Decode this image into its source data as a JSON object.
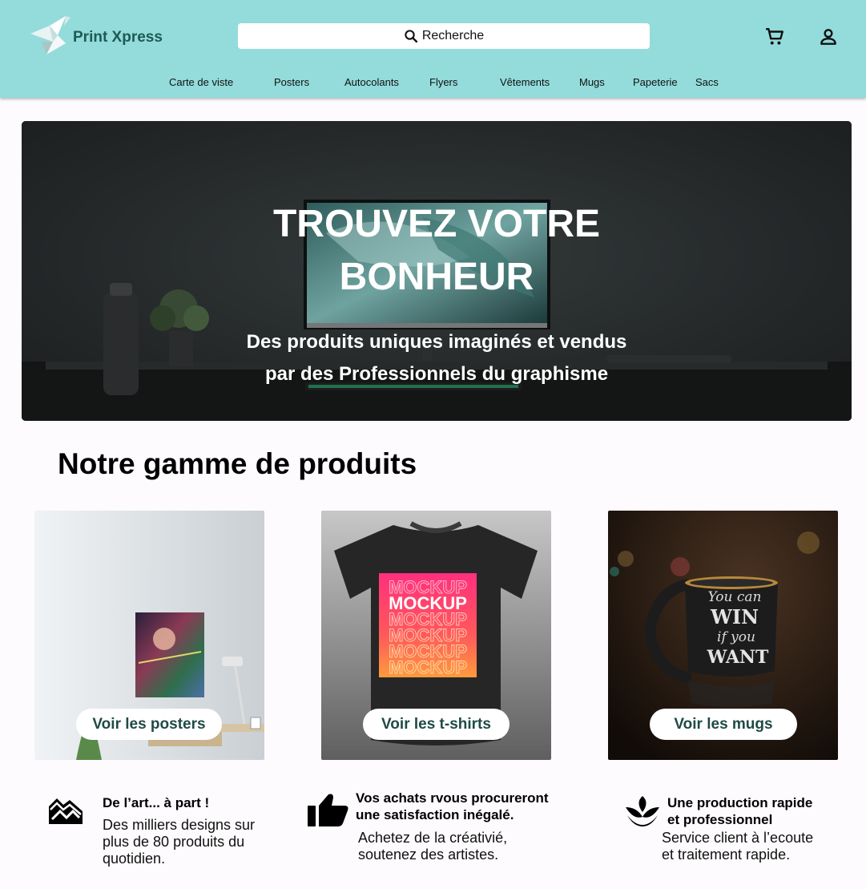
{
  "header": {
    "brand": "Print Xpress",
    "search_label": "Recherche",
    "nav": [
      "Carte de viste",
      "Posters",
      "Autocolants",
      "Flyers",
      "Vêtements",
      "Mugs",
      "Papeterie",
      "Sacs"
    ],
    "icons": [
      "origami-bird-logo",
      "search-icon",
      "cart-icon",
      "account-icon"
    ],
    "colors": {
      "header_bg": "#93dcdb",
      "brand_text": "#1f5a55"
    }
  },
  "hero": {
    "title_line1": "TROUVEZ VOTRE",
    "title_line2": "BONHEUR",
    "subtitle_line1": "Des produits uniques imaginés et vendus",
    "subtitle_line2": "par des Professionnels du graphisme"
  },
  "products": {
    "title": "Notre gamme de produits",
    "cards": [
      {
        "button": "Voir les posters"
      },
      {
        "button": "Voir les t-shirts",
        "mockup_text": "MOCKUP"
      },
      {
        "button": "Voir les mugs",
        "mug_text": [
          "You can",
          "WIN",
          "if you",
          "WANT"
        ]
      }
    ]
  },
  "features": [
    {
      "icon": "art-mountain-icon",
      "title_lines": [
        "De l’art... à part !"
      ],
      "text_lines": [
        "Des milliers designs sur",
        "plus de 80 produits du",
        "quotidien."
      ]
    },
    {
      "icon": "thumbs-up-icon",
      "title_lines": [
        "Vos achats rvous procureront",
        "une satisfaction inégalé."
      ],
      "text_lines": [
        "Achetez de la créativié,",
        "soutenez des artistes."
      ]
    },
    {
      "icon": "lotus-icon",
      "title_lines": [
        "Une production rapide",
        "et professionnel"
      ],
      "text_lines": [
        "Service client à l’ecoute",
        "et traitement rapide."
      ]
    }
  ]
}
